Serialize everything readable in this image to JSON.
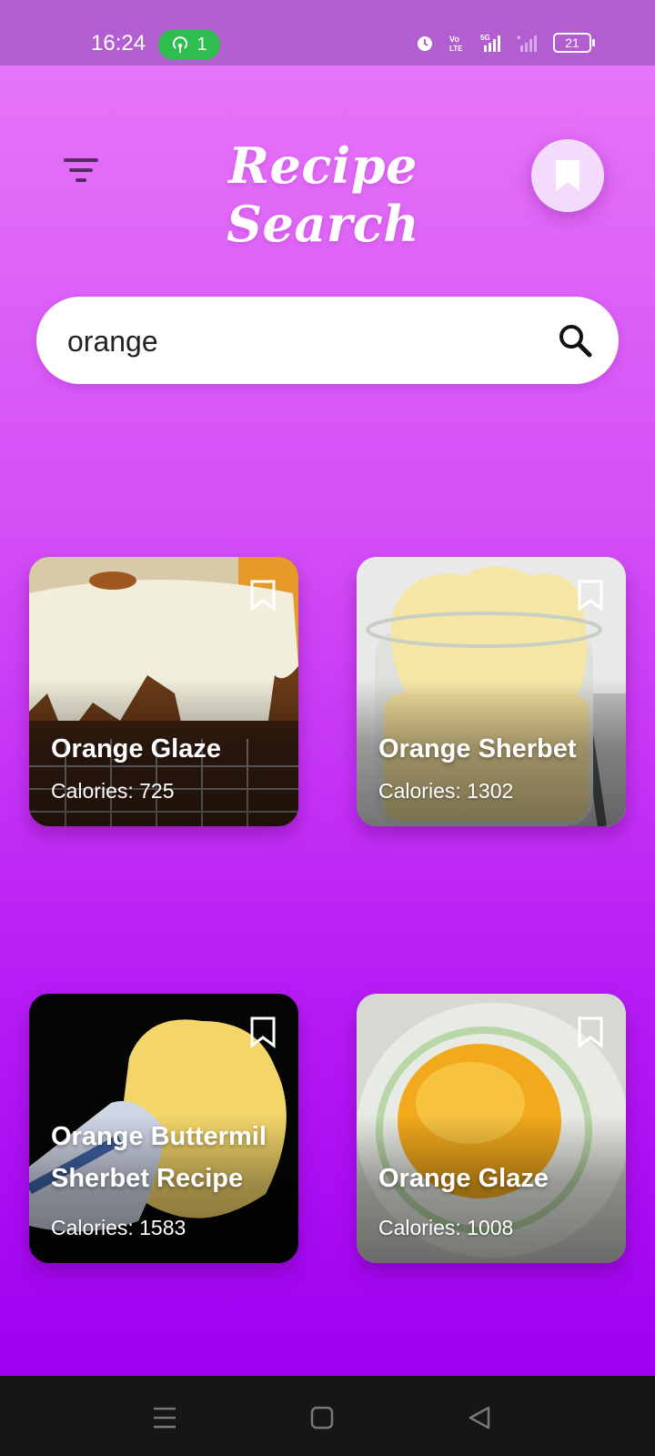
{
  "status_bar": {
    "time": "16:24",
    "hotspot_count": "1",
    "battery": "21",
    "icons": [
      "alarm-icon",
      "volte-icon",
      "5g-signal-icon",
      "signal-icon",
      "battery-icon"
    ]
  },
  "header": {
    "title": "Recipe Search",
    "filter_icon": "filter-icon",
    "bookmark_icon": "bookmark-icon"
  },
  "search": {
    "value": "orange",
    "placeholder": "",
    "icon": "search-icon"
  },
  "recipes": [
    {
      "title": "Orange Glaze",
      "calories": "Calories: 725",
      "bookmark_icon": "bookmark-outline-icon"
    },
    {
      "title": "Orange Sherbet",
      "calories": "Calories: 1302",
      "bookmark_icon": "bookmark-outline-icon"
    },
    {
      "title_line1": "Orange Buttermil",
      "title_line2": "Sherbet Recipe",
      "calories": "Calories: 1583",
      "bookmark_icon": "bookmark-outline-icon"
    },
    {
      "title": "Orange Glaze",
      "calories": "Calories: 1008",
      "bookmark_icon": "bookmark-outline-icon"
    }
  ],
  "nav_bar": {
    "icons": [
      "menu-icon",
      "home-icon",
      "back-icon"
    ]
  },
  "colors": {
    "gradient_top": "#e87af8",
    "gradient_bottom": "#9d00f0",
    "fab_background": "#f3dcfb",
    "hotspot_green": "#2ebd4f"
  }
}
